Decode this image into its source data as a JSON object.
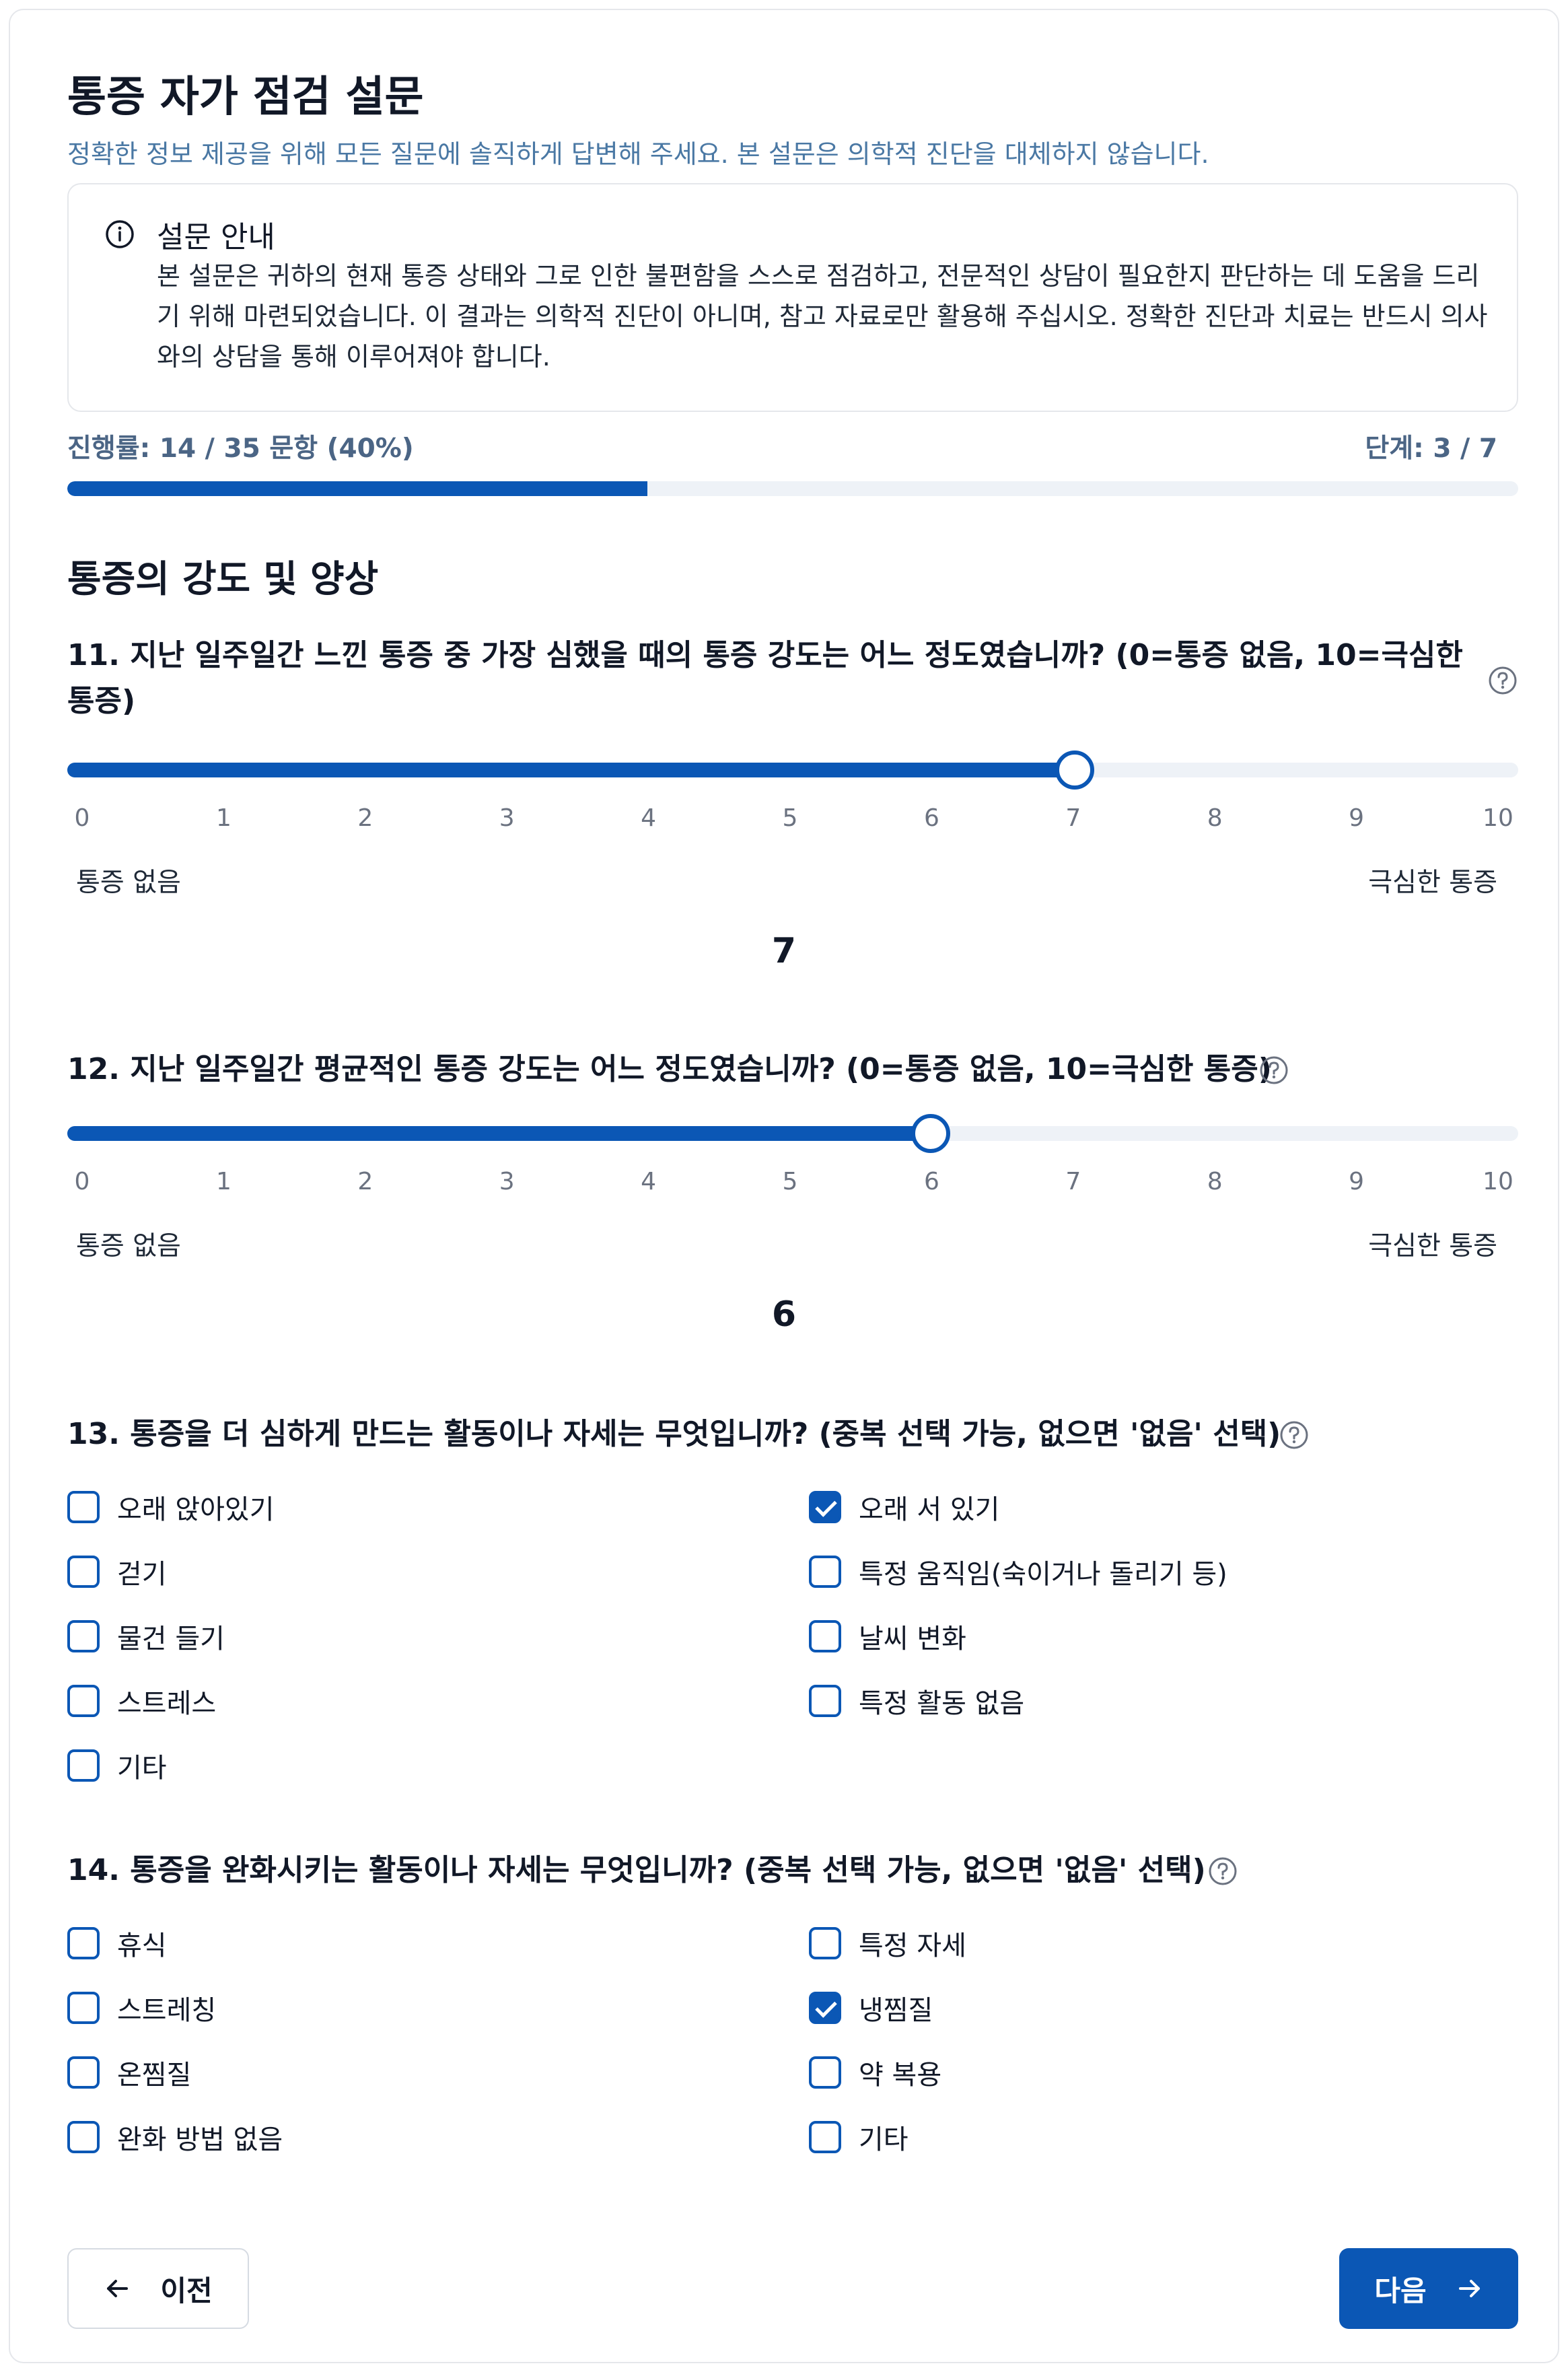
{
  "header": {
    "title": "통증 자가 점검 설문",
    "subtitle": "정확한 정보 제공을 위해 모든 질문에 솔직하게 답변해 주세요. 본 설문은 의학적 진단을 대체하지 않습니다."
  },
  "notice": {
    "icon": "info-icon",
    "title": "설문 안내",
    "body": "본 설문은 귀하의 현재 통증 상태와 그로 인한 불편함을 스스로 점검하고, 전문적인 상담이 필요한지 판단하는 데 도움을 드리기 위해 마련되었습니다. 이 결과는 의학적 진단이 아니며, 참고 자료로만 활용해 주십시오. 정확한 진단과 치료는 반드시 의사와의 상담을 통해 이루어져야 합니다."
  },
  "progress": {
    "label": "진행률: 14 / 35 문항 (40%)",
    "fraction": 0.4,
    "step_label": "단계: 3 / 7"
  },
  "section": {
    "title": "통증의 강도 및 양상"
  },
  "questions": {
    "q11": {
      "title": "11. 지난 일주일간 느낀 통증 중 가장 심했을 때의 통증 강도는 어느 정도였습니까? (0=통증 없음, 10=극심한 통증)",
      "min": 0,
      "max": 10,
      "value": 7,
      "value_label": "7",
      "ticks": [
        "0",
        "1",
        "2",
        "3",
        "4",
        "5",
        "6",
        "7",
        "8",
        "9",
        "10"
      ],
      "min_label": "통증 없음",
      "max_label": "극심한 통증"
    },
    "q12": {
      "title": "12. 지난 일주일간 평균적인 통증 강도는 어느 정도였습니까? (0=통증 없음, 10=극심한 통증)",
      "min": 0,
      "max": 10,
      "value": 6,
      "value_label": "6",
      "ticks": [
        "0",
        "1",
        "2",
        "3",
        "4",
        "5",
        "6",
        "7",
        "8",
        "9",
        "10"
      ],
      "min_label": "통증 없음",
      "max_label": "극심한 통증"
    },
    "q13": {
      "title": "13. 통증을 더 심하게 만드는 활동이나 자세는 무엇입니까? (중복 선택 가능, 없으면 '없음' 선택)",
      "options": [
        {
          "label": "오래 앉아있기",
          "checked": false
        },
        {
          "label": "오래 서 있기",
          "checked": true
        },
        {
          "label": "걷기",
          "checked": false
        },
        {
          "label": "특정 움직임(숙이거나 돌리기 등)",
          "checked": false
        },
        {
          "label": "물건 들기",
          "checked": false
        },
        {
          "label": "날씨 변화",
          "checked": false
        },
        {
          "label": "스트레스",
          "checked": false
        },
        {
          "label": "특정 활동 없음",
          "checked": false
        },
        {
          "label": "기타",
          "checked": false
        }
      ]
    },
    "q14": {
      "title": "14. 통증을 완화시키는 활동이나 자세는 무엇입니까? (중복 선택 가능, 없으면 '없음' 선택)",
      "options": [
        {
          "label": "휴식",
          "checked": false
        },
        {
          "label": "특정 자세",
          "checked": false
        },
        {
          "label": "스트레칭",
          "checked": false
        },
        {
          "label": "냉찜질",
          "checked": true
        },
        {
          "label": "온찜질",
          "checked": false
        },
        {
          "label": "약 복용",
          "checked": false
        },
        {
          "label": "완화 방법 없음",
          "checked": false
        },
        {
          "label": "기타",
          "checked": false
        }
      ]
    }
  },
  "nav": {
    "prev_label": "이전",
    "next_label": "다음"
  },
  "colors": {
    "accent": "#0b57b5",
    "track": "#eef2f7",
    "subtitle": "#4a78a4"
  }
}
